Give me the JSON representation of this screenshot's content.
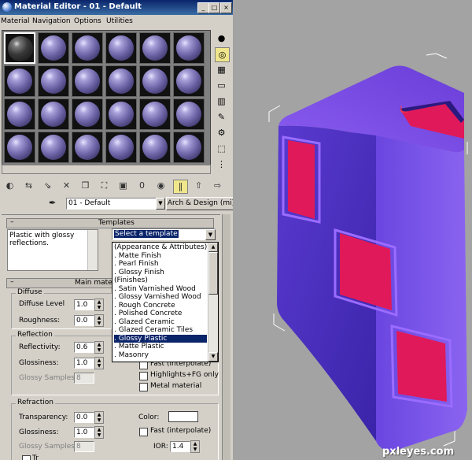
{
  "window": {
    "title": "Material Editor - 01 - Default"
  },
  "menu": [
    "Material",
    "Navigation",
    "Options",
    "Utilities"
  ],
  "material_name": "01 - Default",
  "material_type": "Arch & Design (mi)",
  "templates": {
    "header": "Templates",
    "description": "Plastic with glossy reflections.",
    "select_value": "Select a template",
    "options": [
      "(Appearance & Attributes)",
      ". Matte Finish",
      ". Pearl Finish",
      ". Glossy Finish",
      "(Finishes)",
      ". Satin Varnished Wood",
      ". Glossy Varnished Wood",
      ". Rough Concrete",
      ". Polished Concrete",
      ". Glazed Ceramic",
      ". Glazed Ceramic Tiles",
      ". Glossy Plastic",
      ". Matte Plastic",
      ". Masonry"
    ],
    "selected_index": 11
  },
  "main_material": {
    "header": "Main materi",
    "diffuse": {
      "group": "Diffuse",
      "level_label": "Diffuse Level",
      "level_value": "1.0",
      "roughness_label": "Roughness:",
      "roughness_value": "0.0"
    },
    "reflection": {
      "group": "Reflection",
      "reflectivity_label": "Reflectivity:",
      "reflectivity_value": "0.6",
      "glossiness_label": "Glossiness:",
      "glossiness_value": "1.0",
      "glossy_samples_label": "Glossy Samples:",
      "glossy_samples_value": "8",
      "fast_label": "Fast (interpolate)",
      "highlights_label": "Highlights+FG only",
      "metal_label": "Metal material"
    },
    "refraction": {
      "group": "Refraction",
      "transparency_label": "Transparency:",
      "transparency_value": "0.0",
      "glossiness_label": "Glossiness:",
      "glossiness_value": "1.0",
      "glossy_samples_label": "Glossy Samples:",
      "glossy_samples_value": "8",
      "color_label": "Color:",
      "fast_label": "Fast (interpolate)",
      "ior_label": "IOR:",
      "ior_value": "1.4",
      "translucency_label": "Tr"
    }
  },
  "slot_rows": [
    [
      {
        "id": "slot-1"
      },
      {
        "id": "slot-2"
      },
      {
        "id": "slot-3"
      },
      {
        "id": "slot-4"
      },
      {
        "id": "slot-5"
      },
      {
        "id": "slot-6"
      }
    ],
    [
      {
        "id": "slot-7"
      },
      {
        "id": "slot-8"
      },
      {
        "id": "slot-9"
      },
      {
        "id": "slot-10"
      },
      {
        "id": "slot-11"
      },
      {
        "id": "slot-12"
      }
    ],
    [
      {
        "id": "slot-13"
      },
      {
        "id": "slot-14"
      },
      {
        "id": "slot-15"
      },
      {
        "id": "slot-16"
      },
      {
        "id": "slot-17"
      },
      {
        "id": "slot-18"
      }
    ],
    [
      {
        "id": "slot-19"
      },
      {
        "id": "slot-20"
      },
      {
        "id": "slot-21"
      },
      {
        "id": "slot-22"
      },
      {
        "id": "slot-23"
      },
      {
        "id": "slot-24"
      }
    ]
  ],
  "side_tools": [
    "sample-type-icon",
    "backlight-icon",
    "background-icon",
    "uv-tiling-icon",
    "video-color-check-icon",
    "make-preview-icon",
    "options-icon",
    "select-by-material-icon",
    "material-navigator-icon"
  ],
  "toolbar_icons": [
    "get-material-icon",
    "put-to-scene-icon",
    "assign-to-selection-icon",
    "reset-material-icon",
    "make-copy-icon",
    "make-unique-icon",
    "put-to-library-icon",
    "material-id-channel-icon",
    "show-in-viewport-icon",
    "show-end-result-icon",
    "go-to-parent-icon",
    "go-forward-icon"
  ],
  "watermark": "pxleyes.com",
  "colors": {
    "cube_face": "#6a3ed8",
    "cube_hole": "#e0195a",
    "selection": "#0a246a"
  }
}
